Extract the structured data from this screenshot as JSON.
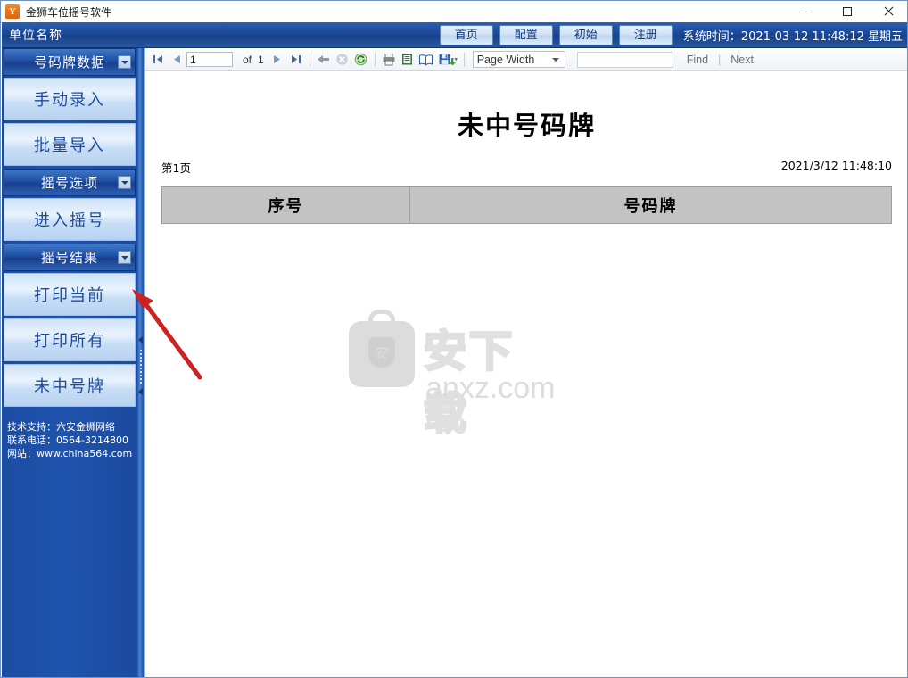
{
  "window": {
    "title": "金狮车位摇号软件",
    "icon": "app-logo-icon",
    "minimize": "—",
    "maximize": "□",
    "close": "✕"
  },
  "header": {
    "company_name": "单位名称",
    "buttons": [
      {
        "label": "首页",
        "name": "home"
      },
      {
        "label": "配置",
        "name": "config"
      },
      {
        "label": "初始",
        "name": "init"
      },
      {
        "label": "注册",
        "name": "register"
      }
    ],
    "system_time": "系统时间：2021-03-12 11:48:12 星期五",
    "accent_color": "#1a4795"
  },
  "sidebar": {
    "groups": [
      {
        "title": "号码牌数据",
        "items": [
          {
            "label": "手动录入"
          },
          {
            "label": "批量导入"
          }
        ]
      },
      {
        "title": "摇号选项",
        "items": [
          {
            "label": "进入摇号"
          }
        ]
      },
      {
        "title": "摇号结果",
        "items": [
          {
            "label": "打印当前"
          },
          {
            "label": "打印所有"
          },
          {
            "label": "未中号牌"
          }
        ]
      }
    ],
    "footer": {
      "line1": "技术支持：六安金狮网络",
      "line2": "联系电话：0564-3214800",
      "line3": "网站：www.china564.com"
    },
    "background_color": "#1d4fa5"
  },
  "toolbar": {
    "first_page_icon": "first-page-icon",
    "prev_page_icon": "previous-page-icon",
    "page_number": "1",
    "of_label": "of",
    "page_count": "1",
    "next_page_icon": "next-page-icon",
    "last_page_icon": "last-page-icon",
    "back_icon": "back-arrow-icon",
    "stop_icon": "stop-icon",
    "refresh_icon": "refresh-icon",
    "print_icon": "print-icon",
    "page_setup_icon": "page-setup-icon",
    "print_layout_icon": "print-layout-icon",
    "export_icon": "export-save-icon",
    "zoom_value": "Page Width",
    "find_value": "",
    "find_label": "Find",
    "separator": "|",
    "next_label": "Next"
  },
  "report": {
    "title": "未中号码牌",
    "page_label": "第1页",
    "generated_at": "2021/3/12 11:48:10",
    "columns": [
      {
        "label": "序号"
      },
      {
        "label": "号码牌"
      }
    ],
    "rows": [],
    "watermark": {
      "text_cn": "安下载",
      "text_domain": "anxz.com",
      "badge_glyph": "安",
      "color": "#dcdcdc"
    }
  },
  "annotation": {
    "arrow_color": "#cc2222",
    "points_to": "打印当前"
  }
}
